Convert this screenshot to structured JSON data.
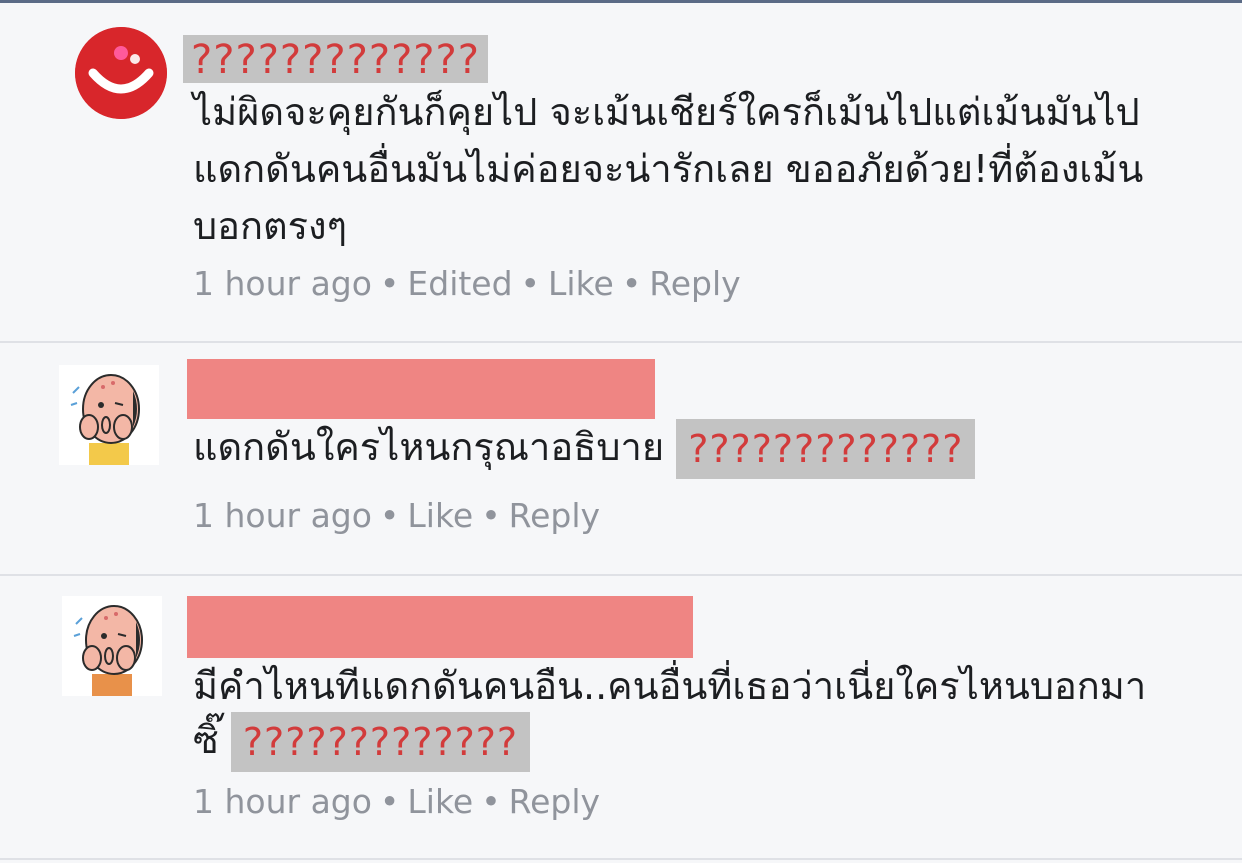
{
  "comments": [
    {
      "name_censored": "?????????????",
      "text_lines": [
        "ไม่ผิดจะคุยกันก็คุยไป จะเม้นเชียร์ใครก็เม้นไปแต่เม้นมันไป",
        "แดกดันคนอื่นมันไม่ค่อยจะน่ารักเลย ขออภัยด้วย!ที่ต้องเม้น",
        "บอกตรงๆ"
      ],
      "time": "1 hour ago",
      "edited": "Edited",
      "like": "Like",
      "reply": "Reply"
    },
    {
      "text": "แดกดันใครไหนกรุณาอธิบาย",
      "censored": "?????????????",
      "time": "1 hour ago",
      "like": "Like",
      "reply": "Reply"
    },
    {
      "text_line1": "มีคำไหนทีแดกดันคนอืน..คนอื่นที่เธอว่าเนี่ยใครไหนบอกมา",
      "text_line2": "ซิ๊",
      "censored": "?????????????",
      "time": "1 hour ago",
      "like": "Like",
      "reply": "Reply"
    }
  ],
  "separator": "•",
  "colors": {
    "background": "#f6f7f9",
    "redaction_pink": "#ef8583",
    "censor_gray": "#c3c3c3",
    "censor_red": "#d23b3b",
    "meta_gray": "#90949c",
    "avatar_red": "#d8262b"
  },
  "icons": {
    "avatar_1": "smiley-face-avatar",
    "avatar_2": "bald-cartoon-man-avatar",
    "avatar_3": "bald-cartoon-man-avatar"
  }
}
